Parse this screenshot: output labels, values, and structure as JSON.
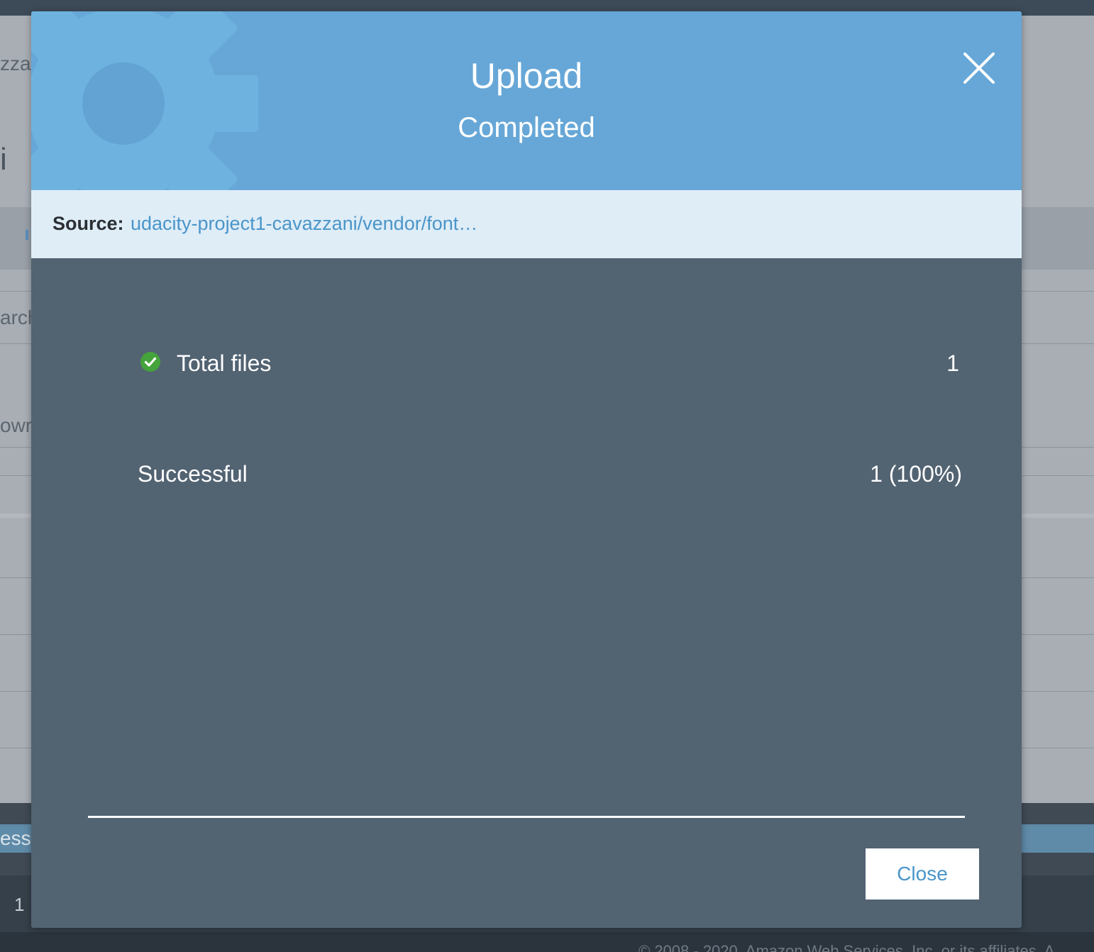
{
  "background": {
    "fragments": {
      "bucket_name_partial": "zza",
      "heading_partial": "i",
      "search_partial": "arch",
      "owner_partial": "owr",
      "status_partial": "essf",
      "row_count": "1",
      "footer_text": "© 2008 - 2020, Amazon Web Services, Inc. or its affiliates. A"
    }
  },
  "modal": {
    "title": "Upload",
    "subtitle": "Completed",
    "header_color": "#66a7d7",
    "icons": {
      "close": "close-icon",
      "decor": "gear-icon",
      "status": "check-circle-icon"
    },
    "source": {
      "label": "Source:",
      "value": "udacity-project1-cavazzani/vendor/font…"
    },
    "stats": {
      "total_files_label": "Total files",
      "total_files_value": "1",
      "successful_label": "Successful",
      "successful_value": "1 (100%)"
    },
    "progress_percent": 100,
    "close_button_label": "Close"
  }
}
